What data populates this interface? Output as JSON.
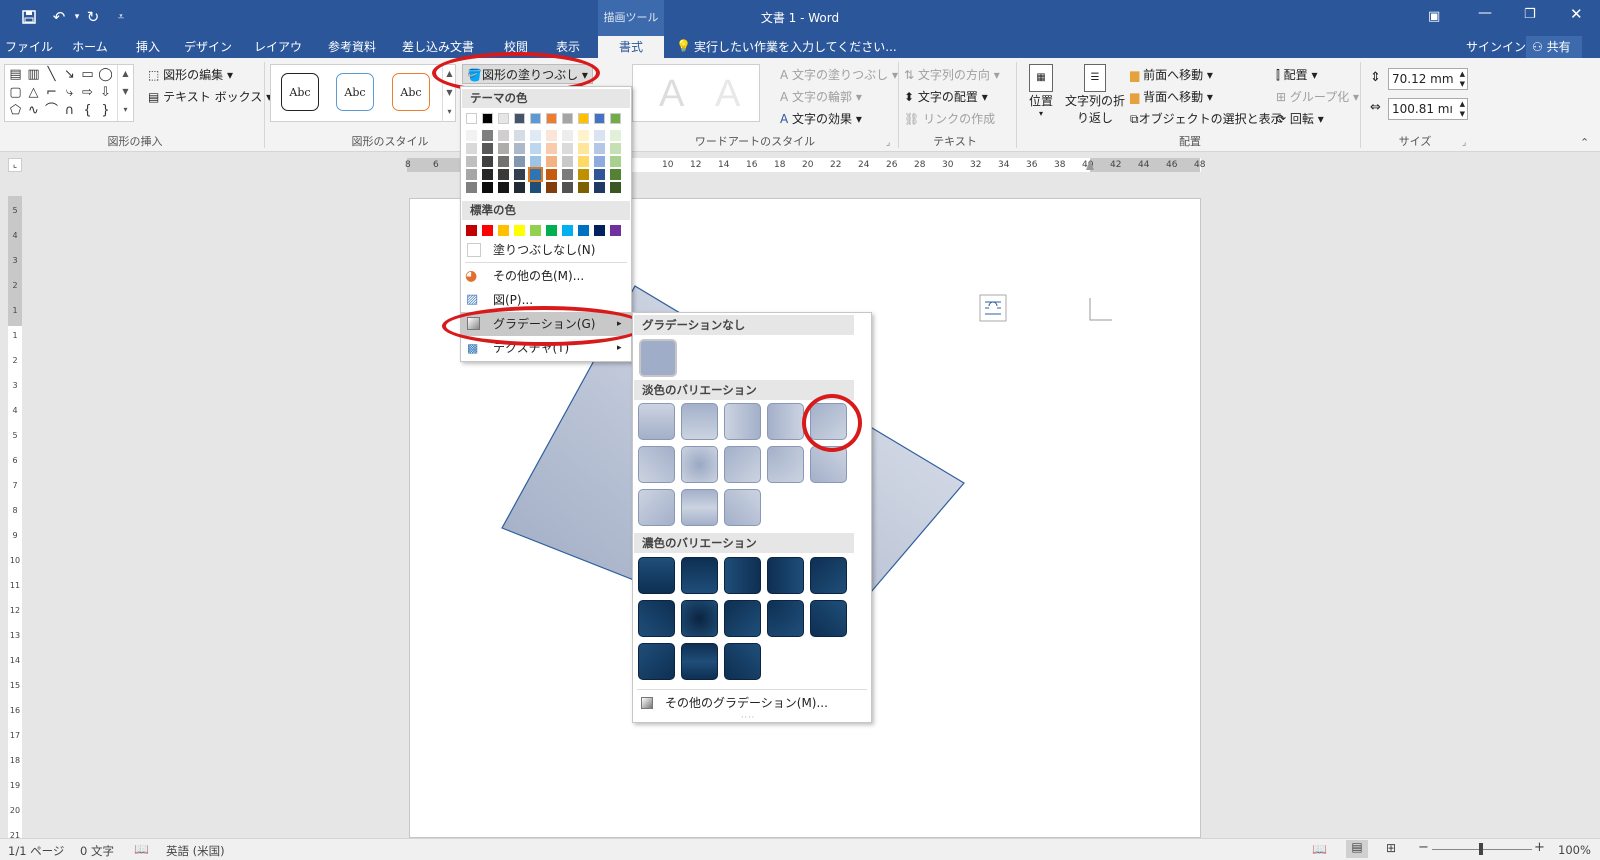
{
  "titlebar": {
    "doc_title": "文書 1 - Word",
    "context_tab": "描画ツール",
    "share": "共有",
    "signin": "サインイン",
    "tell_me": "実行したい作業を入力してください..."
  },
  "tabs": [
    "ファイル",
    "ホーム",
    "挿入",
    "デザイン",
    "レイアウト",
    "参考資料",
    "差し込み文書",
    "校閲",
    "表示",
    "書式"
  ],
  "ribbon": {
    "insert_shapes": {
      "label": "図形の挿入",
      "edit_shape": "図形の編集",
      "text_box": "テキスト ボックス"
    },
    "shape_styles": {
      "label": "図形のスタイル",
      "sample": "Abc",
      "fill_button": "図形の塗りつぶし"
    },
    "wordart": {
      "label": "ワードアートのスタイル",
      "text_fill": "文字の塗りつぶし",
      "text_outline": "文字の輪郭",
      "text_effects": "文字の効果",
      "sample": "A"
    },
    "text": {
      "label": "テキスト",
      "direction": "文字列の方向",
      "align": "文字の配置",
      "link": "リンクの作成"
    },
    "arrange": {
      "label": "配置",
      "position": "位置",
      "wrap": "文字列の折り返し",
      "wrap_l1": "文字列の折",
      "wrap_l2": "り返し",
      "forward": "前面へ移動",
      "backward": "背面へ移動",
      "selection_pane": "オブジェクトの選択と表示",
      "align": "配置",
      "group": "グループ化",
      "rotate": "回転"
    },
    "size": {
      "label": "サイズ",
      "height": "70.12 mm",
      "width": "100.81 mı"
    }
  },
  "ruler_numbers": [
    "8",
    "6",
    "10",
    "12",
    "14",
    "16",
    "18",
    "20",
    "22",
    "24",
    "26",
    "28",
    "30",
    "32",
    "34",
    "36",
    "38",
    "40",
    "42",
    "44",
    "46",
    "48"
  ],
  "vruler_numbers": [
    "5",
    "4",
    "3",
    "2",
    "1",
    "1",
    "2",
    "3",
    "4",
    "5",
    "6",
    "7",
    "8",
    "9",
    "10",
    "11",
    "12",
    "13",
    "14",
    "15",
    "16",
    "17",
    "18",
    "19",
    "20",
    "21"
  ],
  "fill_menu": {
    "theme_colors": "テーマの色",
    "standard_colors": "標準の色",
    "no_fill": "塗りつぶしなし(N)",
    "more_colors": "その他の色(M)...",
    "picture": "図(P)...",
    "gradient": "グラデーション(G)",
    "texture": "テクスチャ(T)",
    "theme_top": [
      "#ffffff",
      "#000000",
      "#e7e6e6",
      "#44546a",
      "#5b9bd5",
      "#ed7d31",
      "#a5a5a5",
      "#ffc000",
      "#4472c4",
      "#70ad47"
    ],
    "theme_shades": [
      [
        "#f2f2f2",
        "#7f7f7f",
        "#d0cece",
        "#d6dce5",
        "#deebf7",
        "#fbe5d6",
        "#ededed",
        "#fff2cc",
        "#dae3f3",
        "#e2f0d9"
      ],
      [
        "#d9d9d9",
        "#595959",
        "#aeabab",
        "#adb9ca",
        "#bdd7ee",
        "#f8cbad",
        "#dbdbdb",
        "#ffe699",
        "#b4c7e7",
        "#c5e0b4"
      ],
      [
        "#bfbfbf",
        "#404040",
        "#757171",
        "#8497b0",
        "#9dc3e6",
        "#f4b183",
        "#c9c9c9",
        "#ffd966",
        "#8faadc",
        "#a9d18e"
      ],
      [
        "#a6a6a6",
        "#262626",
        "#3b3838",
        "#333f50",
        "#2e75b6",
        "#c55a11",
        "#7b7b7b",
        "#bf9000",
        "#2f5597",
        "#548235"
      ],
      [
        "#7f7f7f",
        "#0d0d0d",
        "#171616",
        "#222a35",
        "#1f4e79",
        "#843c0c",
        "#525252",
        "#7f6000",
        "#203864",
        "#385723"
      ]
    ],
    "standard": [
      "#c00000",
      "#ff0000",
      "#ffc000",
      "#ffff00",
      "#92d050",
      "#00b050",
      "#00b0f0",
      "#0070c0",
      "#002060",
      "#7030a0"
    ]
  },
  "gradient_menu": {
    "no_gradient": "グラデーションなし",
    "light_variations": "淡色のバリエーション",
    "dark_variations": "濃色のバリエーション",
    "more_gradients": "その他のグラデーション(M)..."
  },
  "status": {
    "page": "1/1 ページ",
    "words": "0 文字",
    "language": "英語 (米国)",
    "zoom": "100%"
  },
  "colors": {
    "accent": "#2b579a",
    "shape_fill": "#b4bfd3",
    "shape_border": "#2e5f9e",
    "highlight": "#d91a1a"
  }
}
